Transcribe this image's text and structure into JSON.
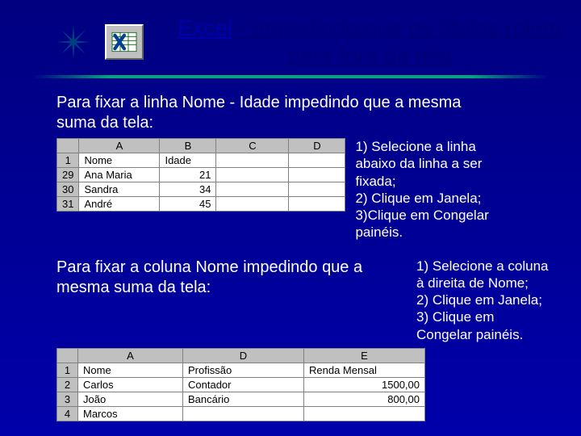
{
  "title": {
    "excel": "Excel",
    "rest": " - Impedindo que os títulos rolem para fora da tela"
  },
  "section1": {
    "intro": "Para fixar a linha Nome - Idade impedindo que a mesma suma da  tela:",
    "steps": "1) Selecione a linha abaixo da linha a ser fixada;\n2) Clique em Janela;\n3)Clique em Congelar painéis.",
    "table": {
      "cols": [
        "A",
        "B",
        "C",
        "D"
      ],
      "rows": [
        {
          "n": "1",
          "cells": [
            "Nome",
            "Idade",
            "",
            ""
          ]
        },
        {
          "n": "29",
          "cells": [
            "Ana Maria",
            "21",
            "",
            ""
          ]
        },
        {
          "n": "30",
          "cells": [
            "Sandra",
            "34",
            "",
            ""
          ]
        },
        {
          "n": "31",
          "cells": [
            "André",
            "45",
            "",
            ""
          ]
        }
      ]
    }
  },
  "section2": {
    "intro": "Para fixar a coluna Nome impedindo que a mesma suma da  tela:",
    "steps": "1) Selecione a coluna à direita de Nome;\n2) Clique em Janela;\n3) Clique em Congelar painéis.",
    "table": {
      "cols": [
        "A",
        "D",
        "E"
      ],
      "rows": [
        {
          "n": "1",
          "cells": [
            "Nome",
            "Profissão",
            "Renda Mensal"
          ]
        },
        {
          "n": "2",
          "cells": [
            "Carlos",
            "Contador",
            "1500,00"
          ]
        },
        {
          "n": "3",
          "cells": [
            "João",
            "Bancário",
            "800,00"
          ]
        },
        {
          "n": "4",
          "cells": [
            "Marcos",
            "",
            ""
          ]
        }
      ]
    }
  }
}
